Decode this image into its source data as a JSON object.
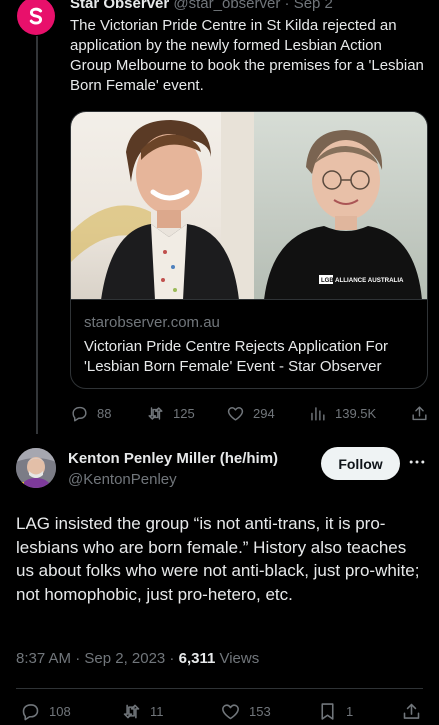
{
  "quoted_tweet": {
    "author_name": "Star Observer",
    "author_handle": "@star_observer",
    "date": "Sep 2",
    "text": "The Victorian Pride Centre in St Kilda rejected an application by the newly formed Lesbian Action Group Melbourne to book the premises for a 'Lesbian Born Female' event.",
    "card": {
      "domain": "starobserver.com.au",
      "title": "Victorian Pride Centre Rejects Application For 'Lesbian Born Female' Event - Star Observer",
      "shirt_text": "ALLIANCE AUSTRALIA",
      "shirt_logo": "LGB"
    },
    "stats": {
      "replies": "88",
      "reposts": "125",
      "likes": "294",
      "views": "139.5K"
    }
  },
  "main_tweet": {
    "author_name": "Kenton Penley Miller (he/him)",
    "author_handle": "@KentonPenley",
    "follow_label": "Follow",
    "text": "LAG insisted the group “is not anti-trans, it is pro-lesbians who are born female.” History also teaches us about folks who were not anti-black, just pro-white; not homophobic, just pro-hetero, etc.",
    "timestamp": "8:37 AM · Sep 2, 2023 · ",
    "views_count": "6,311",
    "views_label": " Views",
    "stats": {
      "replies": "108",
      "reposts": "11",
      "likes": "153",
      "bookmarks": "1"
    }
  },
  "colors": {
    "background": "#000000",
    "text_primary": "#e7e9ea",
    "text_secondary": "#71767b",
    "star_observer_brand": "#e8106b",
    "follow_button_bg": "#eff3f4"
  }
}
